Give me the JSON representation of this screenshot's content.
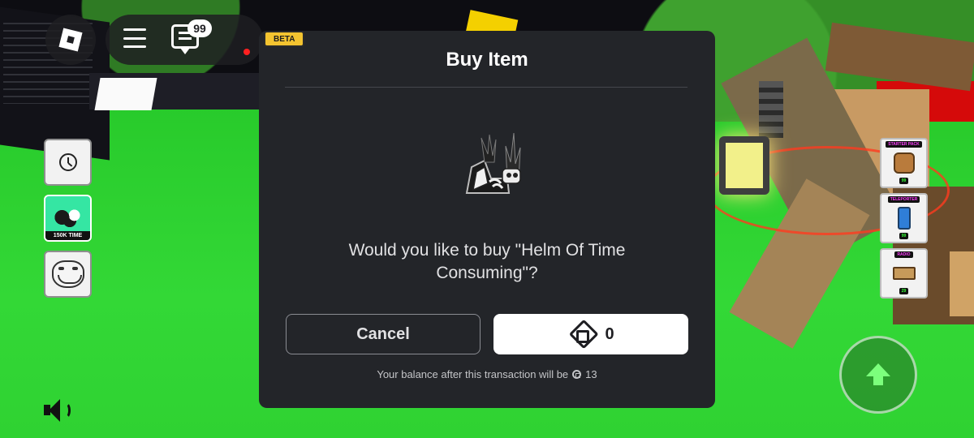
{
  "top_bar": {
    "chat_badge": "99",
    "beta_label": "BETA"
  },
  "hotbar_left": {
    "time_item_label": "150K TIME"
  },
  "tools_right": [
    {
      "title": "STARTER PACK",
      "price": "99",
      "icon": "backpack-icon"
    },
    {
      "title": "TELEPORTER",
      "price": "99",
      "icon": "teleporter-icon"
    },
    {
      "title": "RADIO",
      "price": "29",
      "icon": "radio-icon"
    }
  ],
  "modal": {
    "title": "Buy Item",
    "prompt": "Would you like to buy \"Helm Of Time Consuming\"?",
    "cancel_label": "Cancel",
    "price": "0",
    "balance_text": "Your balance after this transaction will be",
    "balance_value": "13"
  },
  "icons": {
    "menu": "hamburger-icon",
    "chat": "chat-icon",
    "volume": "speaker-icon",
    "jump": "up-arrow-icon",
    "currency": "robux-icon"
  },
  "colors": {
    "modal_bg": "#232529",
    "buy_button_bg": "#ffffff",
    "beta_badge": "#f4c430",
    "grass": "#2bd12b"
  }
}
